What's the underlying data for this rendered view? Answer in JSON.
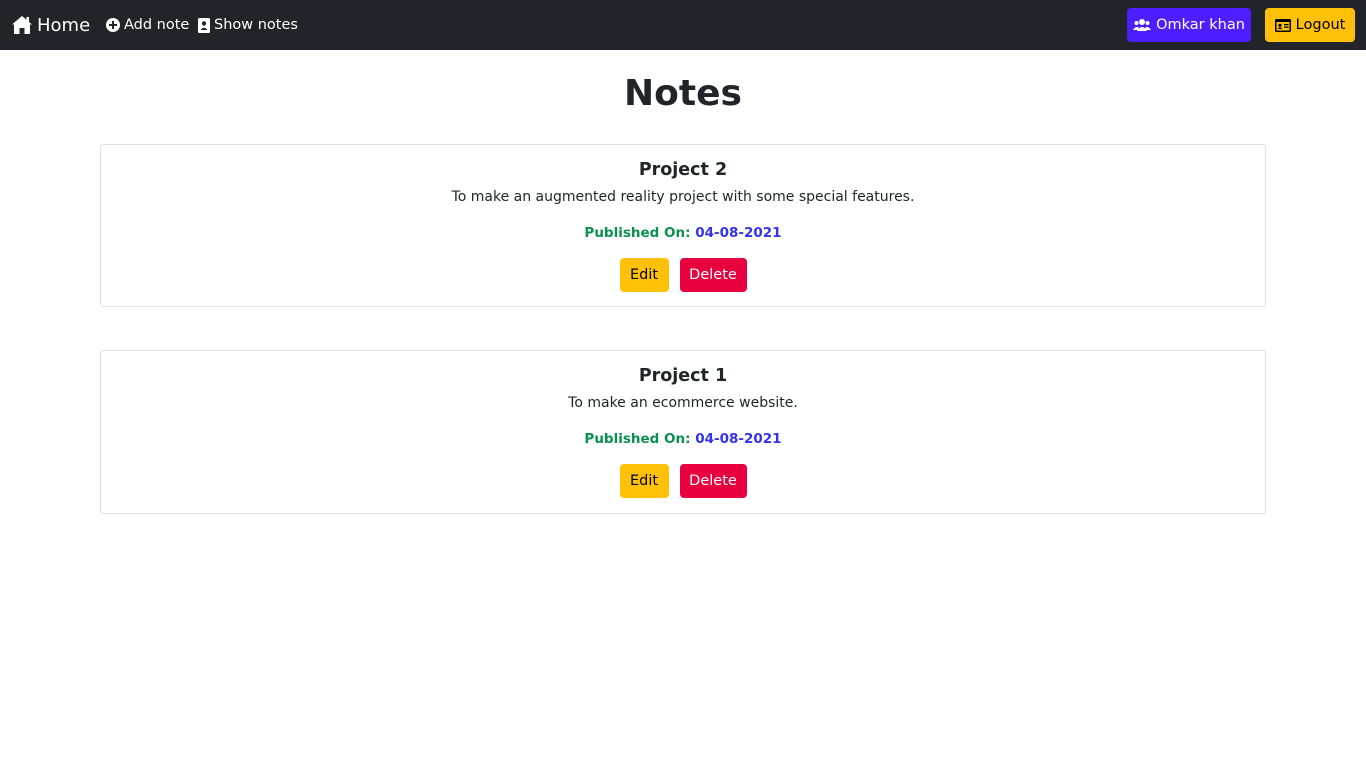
{
  "navbar": {
    "home_label": "Home",
    "add_note_label": "Add note",
    "show_notes_label": "Show notes",
    "user_label": "Omkar khan",
    "logout_label": "Logout",
    "icons": [
      "home-icon",
      "plus-circle-icon",
      "address-book-icon",
      "users-icon",
      "id-card-icon"
    ]
  },
  "page": {
    "title": "Notes"
  },
  "notes": [
    {
      "title": "Project 2",
      "description": "To make an augmented reality project with some special features.",
      "published_label": "Published On:",
      "published_date": "04-08-2021",
      "edit_label": "Edit",
      "delete_label": "Delete"
    },
    {
      "title": "Project 1",
      "description": "To make an ecommerce website.",
      "published_label": "Published On:",
      "published_date": "04-08-2021",
      "edit_label": "Edit",
      "delete_label": "Delete"
    }
  ],
  "colors": {
    "navbar_bg": "#212529",
    "user_button": "#4d1eff",
    "warning": "#ffc107",
    "danger": "#e8003f",
    "published_label": "#0a9150",
    "published_date": "#3333ee"
  }
}
